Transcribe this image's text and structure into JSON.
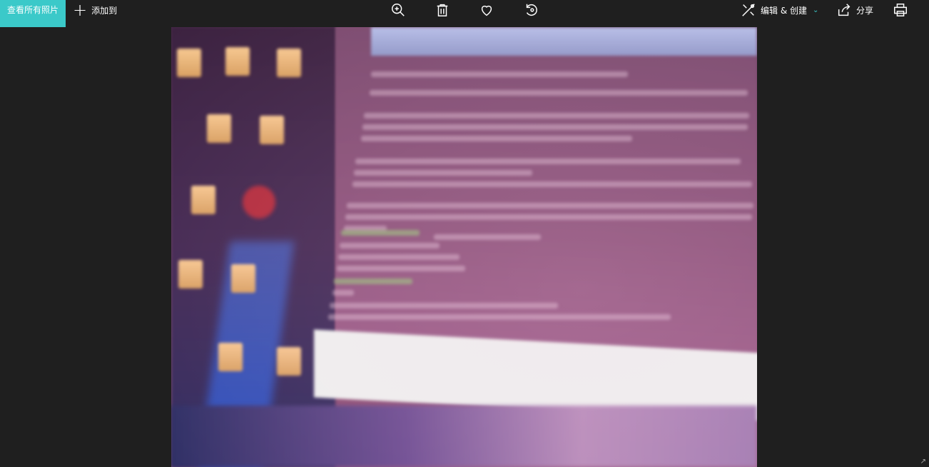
{
  "toolbar": {
    "view_all_label": "查看所有照片",
    "add_to_label": "添加到",
    "edit_create_label": "编辑 & 创建",
    "share_label": "分享"
  },
  "icons": {
    "zoom": "zoom-in-icon",
    "delete": "trash-icon",
    "favorite": "heart-icon",
    "rotate": "rotate-icon",
    "edit": "edit-create-icon",
    "share": "share-icon",
    "print": "print-icon",
    "expand": "expand-arrow-icon"
  },
  "colors": {
    "accent": "#3bc9c9",
    "background": "#1f1f1f"
  }
}
